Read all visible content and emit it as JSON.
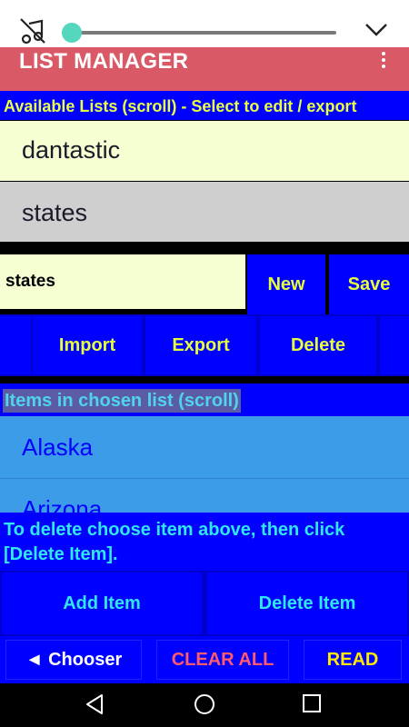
{
  "media": {
    "icon": "music-off-icon",
    "progress": 0.0,
    "collapse_icon": "chevron-down-icon"
  },
  "app_bar": {
    "title": "LIST MANAGER",
    "menu_icon": "overflow-menu-icon",
    "color": "#d95a66"
  },
  "available_lists": {
    "header": "Available Lists (scroll) - Select to edit / export",
    "items": [
      {
        "label": "dantastic"
      },
      {
        "label": "states"
      }
    ]
  },
  "editor": {
    "list_name_value": "states",
    "new_label": "New",
    "save_label": "Save",
    "import_label": "Import",
    "export_label": "Export",
    "delete_label": "Delete"
  },
  "items_section": {
    "header": "Items in chosen list (scroll)",
    "items": [
      {
        "label": "Alaska"
      },
      {
        "label": "Arizona"
      }
    ],
    "hint": "To delete choose item above, then click [Delete Item].",
    "add_item_label": "Add Item",
    "delete_item_label": "Delete Item"
  },
  "bottom_bar": {
    "chooser_label": "◄ Chooser",
    "clear_all_label": "CLEAR ALL",
    "read_label": "READ"
  },
  "nav": {
    "back_icon": "back-icon",
    "home_icon": "home-icon",
    "recents_icon": "recents-icon"
  },
  "colors": {
    "primary_blue": "#0000ff",
    "accent_yellow": "#e6ff3c",
    "accent_cyan": "#30e6f0",
    "list_bg": "#3c9ce8"
  }
}
